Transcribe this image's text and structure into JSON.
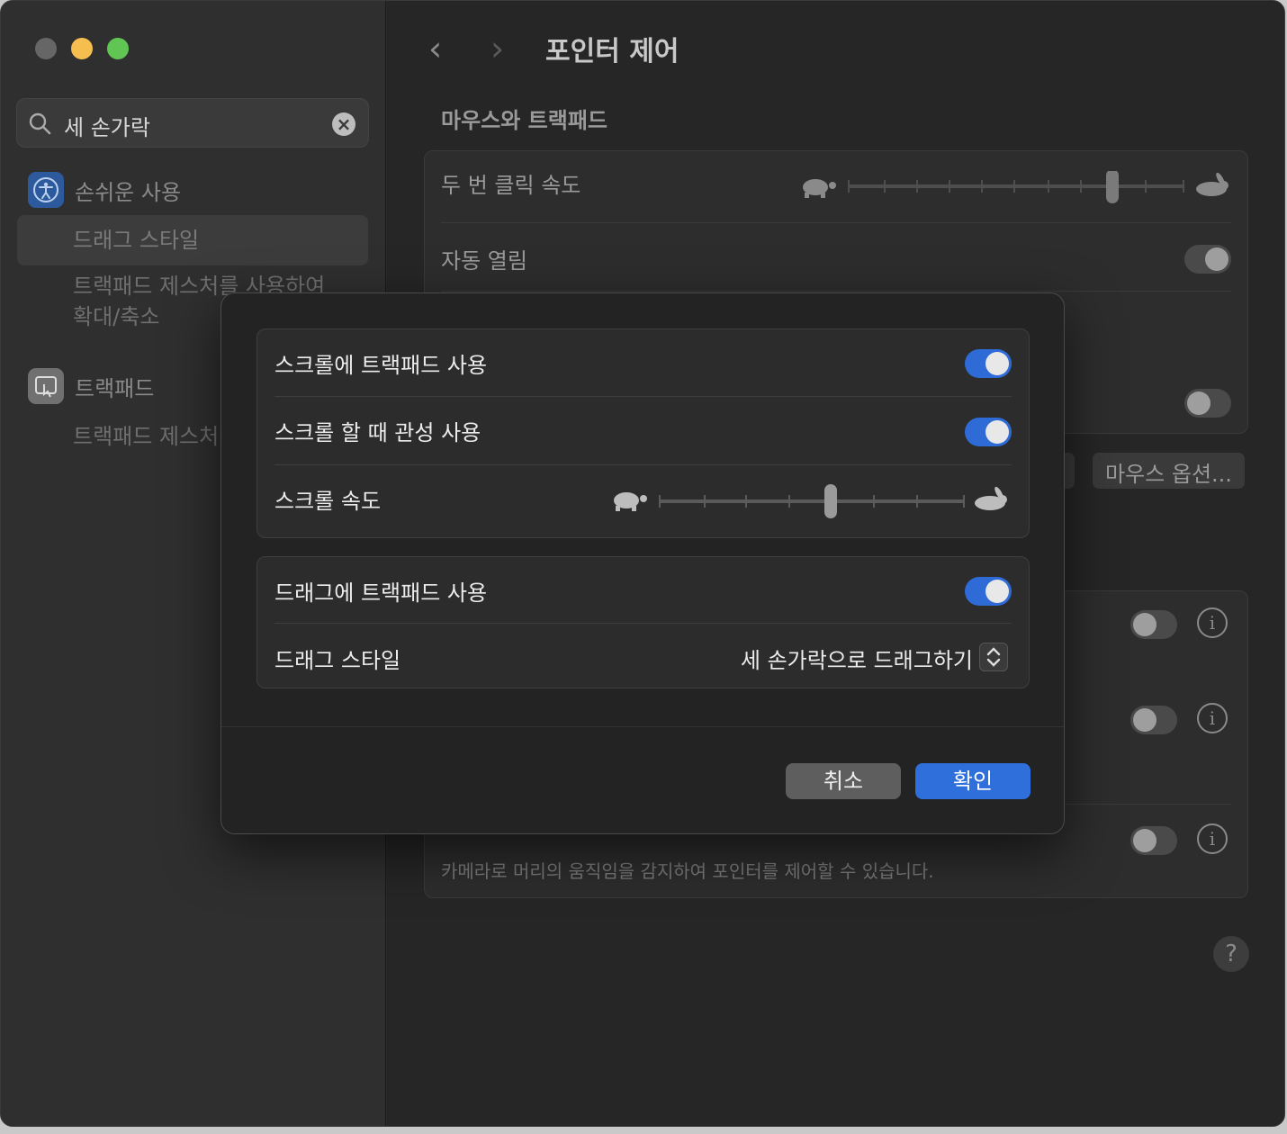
{
  "sidebar": {
    "search": {
      "value": "세 손가락"
    },
    "sections": [
      {
        "label": "손쉬운 사용",
        "icon": "accessibility-icon",
        "items": [
          "드래그 스타일",
          "트랙패드 제스처를 사용하여 확대/축소"
        ]
      },
      {
        "label": "트랙패드",
        "icon": "trackpad-icon",
        "items": [
          "트랙패드 제스처"
        ]
      }
    ],
    "selected_item": "드래그 스타일",
    "sub_line1": "트랙패드 제스처를 사용하여",
    "sub_line2": "확대/축소",
    "trackpad_sub": "트랙패드 제스처"
  },
  "header": {
    "title": "포인터 제어"
  },
  "main": {
    "section_title": "마우스와 트랙패드",
    "double_click_speed": {
      "label": "두 번 클릭 속도",
      "level": 0.83
    },
    "spring_loading": {
      "label": "자동 열림",
      "enabled": true
    },
    "mouse_options_button": "마우스 옵션...",
    "head_pointer": {
      "description": "카메라로 머리의 움직임을 감지하여 포인터를 제어할 수 있습니다."
    }
  },
  "dialog": {
    "scroll_trackpad": {
      "label": "스크롤에 트랙패드 사용",
      "enabled": true
    },
    "inertia": {
      "label": "스크롤 할 때 관성 사용",
      "enabled": true
    },
    "scroll_speed": {
      "label": "스크롤 속도",
      "level": 0.5
    },
    "drag_trackpad": {
      "label": "드래그에 트랙패드 사용",
      "enabled": true
    },
    "drag_style": {
      "label": "드래그 스타일",
      "value": "세 손가락으로 드래그하기"
    },
    "cancel_label": "취소",
    "ok_label": "확인"
  },
  "colors": {
    "accent": "#2f6fdb",
    "window_bg": "#262626",
    "dialog_bg": "#232323"
  }
}
